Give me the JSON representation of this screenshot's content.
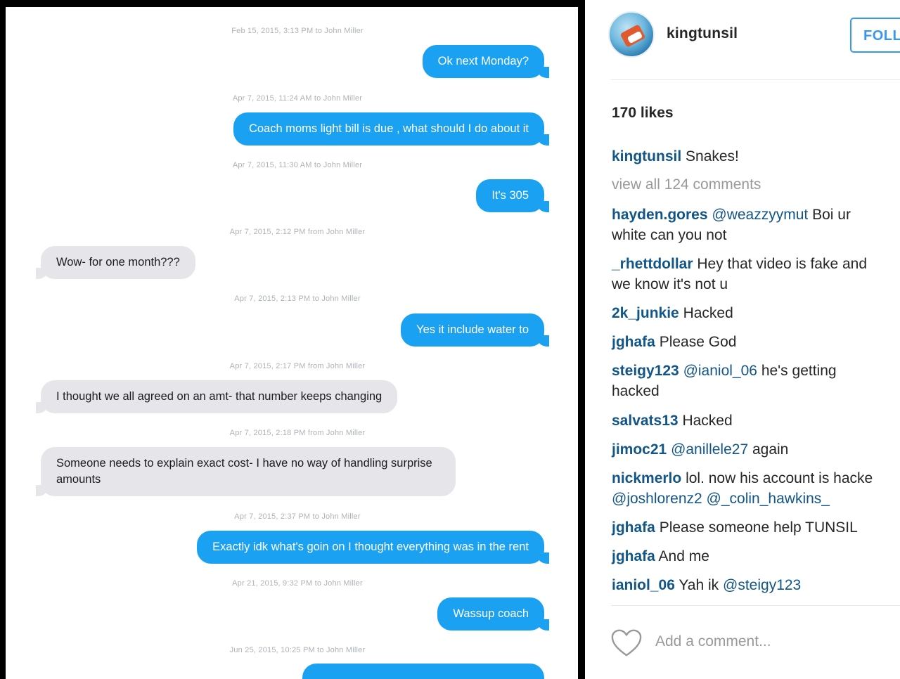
{
  "conversation": {
    "messages": [
      {
        "timestamp": "Feb 15, 2015, 3:13 PM to John Miller",
        "direction": "out",
        "text": "Ok next Monday?"
      },
      {
        "timestamp": "Apr 7, 2015, 11:24 AM to John Miller",
        "direction": "out",
        "text": "Coach moms light bill is due , what should I do about it"
      },
      {
        "timestamp": "Apr 7, 2015, 11:30 AM to John Miller",
        "direction": "out",
        "text": "It's 305"
      },
      {
        "timestamp": "Apr 7, 2015, 2:12 PM from John Miller",
        "direction": "in",
        "text": "Wow- for one month???"
      },
      {
        "timestamp": "Apr 7, 2015, 2:13 PM to John Miller",
        "direction": "out",
        "text": "Yes it include water to"
      },
      {
        "timestamp": "Apr 7, 2015, 2:17 PM from John Miller",
        "direction": "in",
        "text": "I thought we all agreed on an amt- that number keeps changing"
      },
      {
        "timestamp": "Apr 7, 2015, 2:18 PM from John Miller",
        "direction": "in",
        "text": "Someone needs to explain exact cost- I have no way of handling surprise amounts"
      },
      {
        "timestamp": "Apr 7, 2015, 2:37 PM to John Miller",
        "direction": "out",
        "text": "Exactly idk what's goin on I thought everything was in the rent"
      },
      {
        "timestamp": "Apr 21, 2015, 9:32 PM to John Miller",
        "direction": "out",
        "text": "Wassup coach"
      },
      {
        "timestamp": "Jun 25, 2015, 10:25 PM to John Miller",
        "direction": "out",
        "text": ""
      }
    ]
  },
  "post": {
    "username": "kingtunsil",
    "follow_label": "FOLL",
    "likes": "170 likes",
    "caption": {
      "user": "kingtunsil",
      "text": "Snakes!"
    },
    "view_all": "view all 124 comments",
    "comments": [
      {
        "user": "hayden.gores",
        "mention": "@weazzyymut",
        "text": "Boi ur",
        "line2": "white can you not"
      },
      {
        "user": "_rhettdollar",
        "text": "Hey that video is fake and",
        "line2": "we know it's not u"
      },
      {
        "user": "2k_junkie",
        "text": "Hacked"
      },
      {
        "user": "jghafa",
        "text": "Please God"
      },
      {
        "user": "steigy123",
        "mention": "@ianiol_06",
        "text": "he's getting",
        "line2": "hacked"
      },
      {
        "user": "salvats13",
        "text": "Hacked"
      },
      {
        "user": "jimoc21",
        "mention": "@anillele27",
        "text": "again"
      },
      {
        "user": "nickmerlo",
        "text": "lol. now his account is hacke",
        "line2_mentions": "@joshlorenz2 @_colin_hawkins_"
      },
      {
        "user": "jghafa",
        "text": "Please someone help TUNSIL"
      },
      {
        "user": "jghafa",
        "text": "And me"
      },
      {
        "user": "ianiol_06",
        "text": "Yah ik",
        "mention_after": "@steigy123"
      }
    ],
    "add_comment_placeholder": "Add a comment..."
  },
  "colors": {
    "imessage_blue": "#1aa1f2",
    "imessage_gray": "#e5e5ea",
    "instagram_link": "#125688",
    "follow_blue": "#3897f0"
  },
  "icons": {
    "like": "heart-icon"
  }
}
